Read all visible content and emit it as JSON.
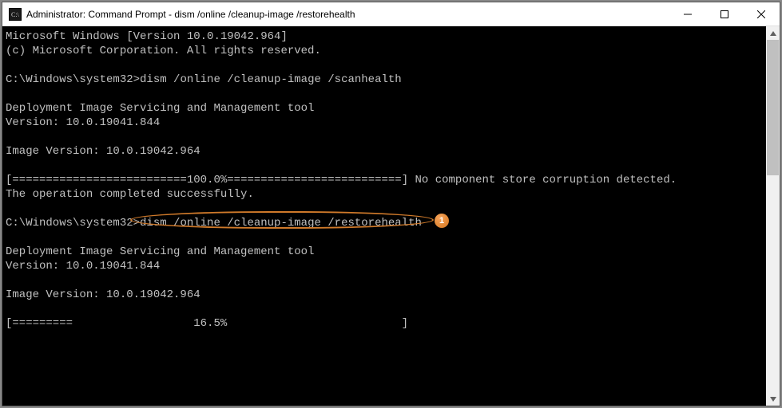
{
  "titlebar": {
    "title": "Administrator: Command Prompt - dism  /online /cleanup-image /restorehealth"
  },
  "terminal": {
    "header_line1": "Microsoft Windows [Version 10.0.19042.964]",
    "header_line2": "(c) Microsoft Corporation. All rights reserved.",
    "prompt": "C:\\Windows\\system32>",
    "cmd1": "dism /online /cleanup-image /scanhealth",
    "dism_tool": "Deployment Image Servicing and Management tool",
    "dism_ver": "Version: 10.0.19041.844",
    "img_ver": "Image Version: 10.0.19042.964",
    "progress_full_prefix": "[==========================",
    "progress_full_pct": "100.0%",
    "progress_full_suffix": "==========================]",
    "no_corruption": " No component store corruption detected.",
    "op_complete": "The operation completed successfully.",
    "cmd2": "dism /online /cleanup-image /restorehealth",
    "progress_partial": "[=========                  16.5%                          ]"
  },
  "annotation": {
    "badge": "1"
  }
}
